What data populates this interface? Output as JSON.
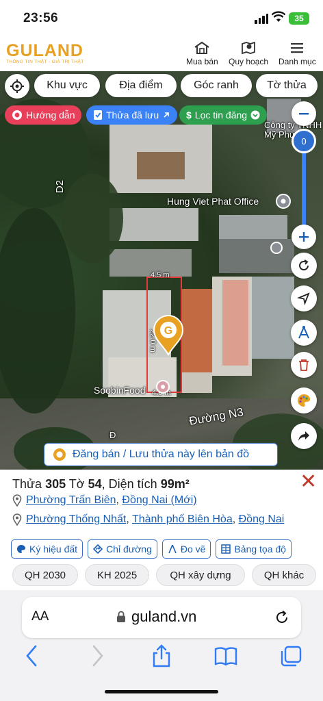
{
  "status": {
    "time": "23:56",
    "battery": "35"
  },
  "header": {
    "logo": "GULAND",
    "tagline": "THÔNG TIN THẬT - GIÁ TRỊ THẬT",
    "nav": [
      {
        "label": "Mua bán",
        "icon": "house-icon"
      },
      {
        "label": "Quy hoạch",
        "icon": "map-pin-icon"
      },
      {
        "label": "Danh mục",
        "icon": "hamburger-icon"
      }
    ]
  },
  "filters": {
    "area": "Khu vực",
    "location": "Địa điểm",
    "boundary": "Góc ranh",
    "sheet": "Tờ thửa"
  },
  "chips": {
    "guide": "Hướng dẫn",
    "saved": "Thửa đã lưu",
    "filter": "Lọc tin đăng"
  },
  "map": {
    "zoom_value": "0",
    "labels": {
      "road_d2": "D2",
      "road_n3": "Đường N3",
      "office": "Hung Viet Phat Office",
      "company": "Công ty TNHH\nMỹ Phương",
      "soobin": "SoobinFood",
      "dim_top": "4.5 m",
      "dim_side": "22.0 m",
      "dim_bottom": "4.6 m",
      "road_hint": "Đ"
    },
    "banner": "Đăng bán / Lưu thửa này lên bản đồ"
  },
  "plot": {
    "prefix": "Thửa ",
    "plot_no": "305",
    "sheet_label": " Tờ ",
    "sheet_no": "54",
    "area_label": ", Diện tích ",
    "area": "99m²",
    "addr_new": {
      "ward": "Phường Trấn Biên",
      "province": "Đồng Nai (Mới)"
    },
    "addr_old": {
      "ward": "Phường Thống Nhất",
      "city": "Thành phố Biên Hòa",
      "province": "Đồng Nai"
    }
  },
  "tools": [
    "Ký hiệu đất",
    "Chỉ đường",
    "Đo vẽ",
    "Bảng tọa độ"
  ],
  "plans": [
    "QH 2030",
    "KH 2025",
    "QH xây dựng",
    "QH khác"
  ],
  "browser": {
    "aa": "AA",
    "url": "guland.vn"
  },
  "colors": {
    "brand": "#e8a122",
    "link": "#1a5fb4",
    "guide_chip": "#e8405a",
    "saved_chip": "#3b82f6",
    "filter_chip": "#2e9e4f",
    "close": "#c0392b"
  }
}
